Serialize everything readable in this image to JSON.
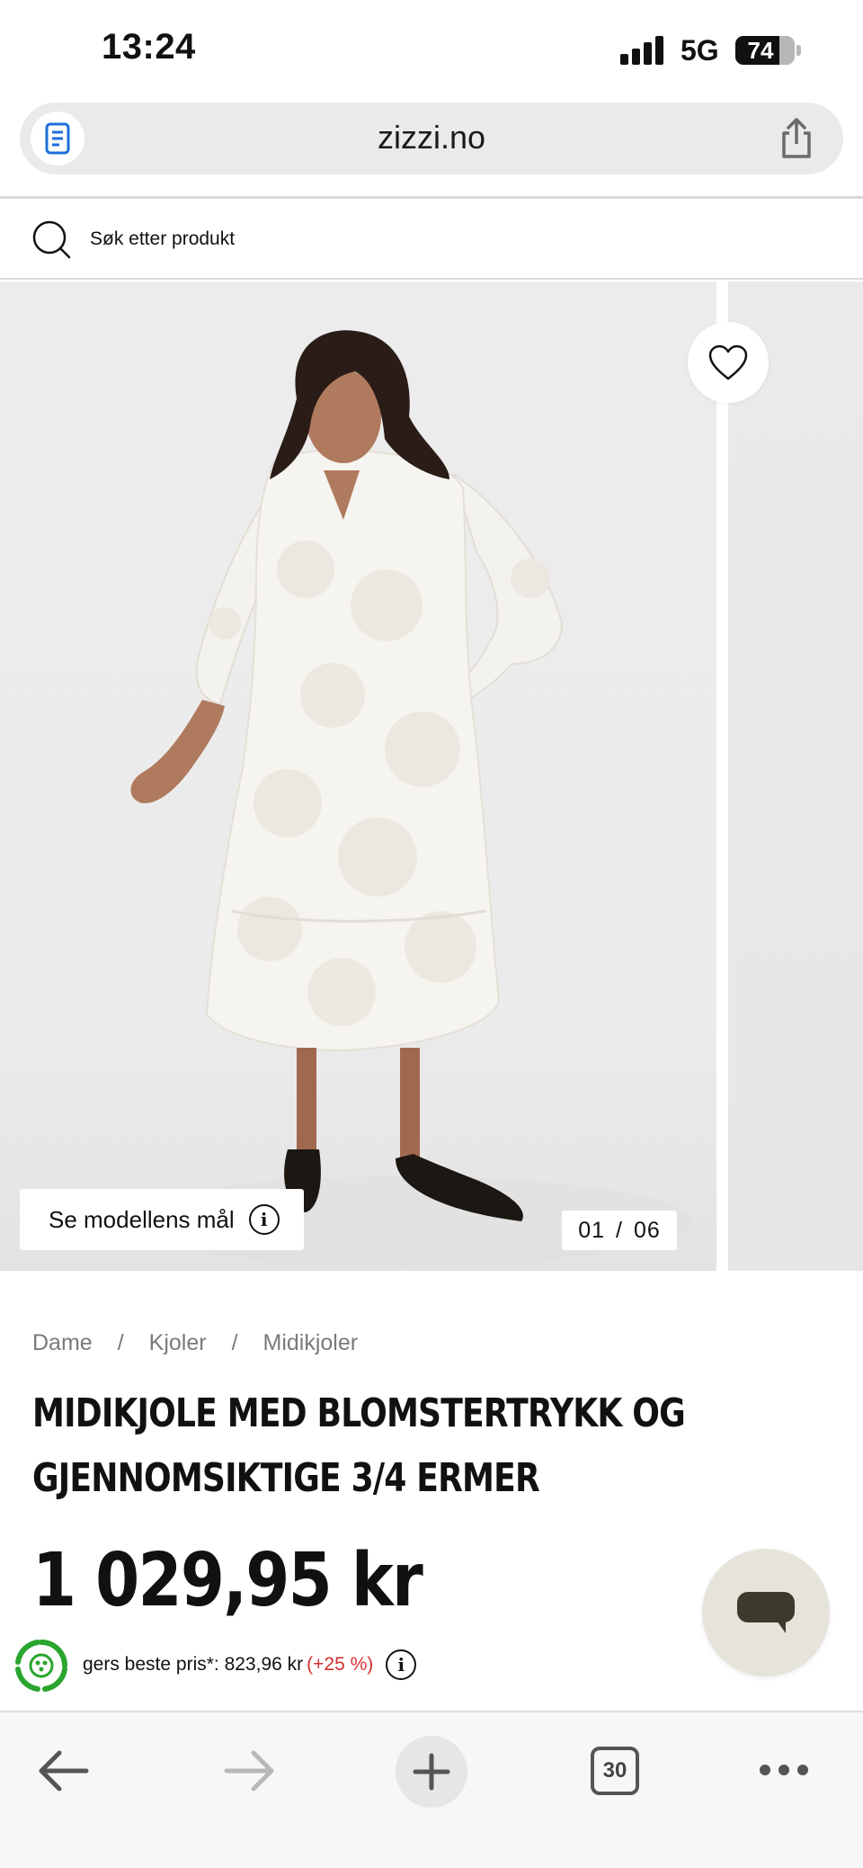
{
  "status_bar": {
    "time": "13:24",
    "network": "5G",
    "battery_percent": "74",
    "battery_level": 0.74
  },
  "browser": {
    "url": "zizzi.no",
    "reader_icon": "reader-icon",
    "share_icon": "share-icon"
  },
  "search": {
    "placeholder": "Søk etter produkt",
    "icon": "search-icon"
  },
  "gallery": {
    "model_measurements_label": "Se modellens mål",
    "current_image": "01",
    "separator": "/",
    "total_images": "06",
    "favorite_icon": "heart-icon"
  },
  "breadcrumb": {
    "items": [
      "Dame",
      "Kjoler",
      "Midikjoler"
    ],
    "separator": "/"
  },
  "product": {
    "title_line1": "MIDIKJOLE MED BLOMSTERTRYKK OG",
    "title_line2": "GJENNOMSIKTIGE 3/4 ERMER",
    "price": "1 029,95 kr",
    "best_price_text": "gers beste pris*: 823,96 kr",
    "best_price_change": "(+25 %)"
  },
  "chat": {
    "icon": "chat-icon"
  },
  "toolbar": {
    "tab_count": "30",
    "icons": [
      "back-arrow-icon",
      "forward-arrow-icon",
      "plus-icon",
      "tabs-icon",
      "more-icon"
    ]
  },
  "colors": {
    "accent_red": "#d9302f",
    "eco_green": "#2aa52e",
    "chat_bg": "#e6e3da",
    "chat_icon": "#3d3a2c"
  }
}
